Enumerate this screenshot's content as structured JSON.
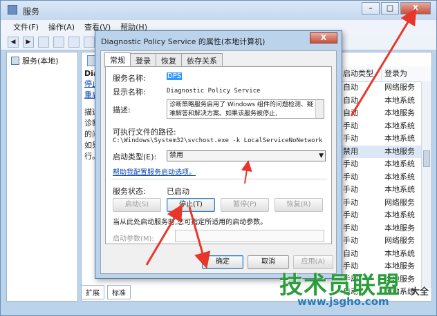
{
  "main": {
    "title": "服务",
    "menu": [
      "文件(F)",
      "操作(A)",
      "查看(V)",
      "帮助(H)"
    ],
    "tree_node": "服务(本地)",
    "desc": {
      "title": "Dia",
      "links": [
        "停止",
        "重启"
      ],
      "text": "描述\n诊断\n的问\n如果\n行。"
    },
    "columns": [
      "启动类型",
      "登录为"
    ],
    "rows": [
      [
        "自动",
        "网络服务"
      ],
      [
        "自动",
        "本地系统"
      ],
      [
        "自动",
        "本地服务"
      ],
      [
        "手动",
        "本地系统"
      ],
      [
        "手动",
        "本地系统"
      ],
      [
        "禁用",
        "本地服务"
      ],
      [
        "手动",
        "本地系统"
      ],
      [
        "手动",
        "本地系统"
      ],
      [
        "手动",
        "本地系统"
      ],
      [
        "手动",
        "网络服务"
      ],
      [
        "手动",
        "本地系统"
      ],
      [
        "手动",
        "本地服务"
      ],
      [
        "手动",
        "网络服务"
      ],
      [
        "自动",
        "本地系统"
      ],
      [
        "手动",
        "本地服务"
      ],
      [
        "手动",
        "本地服务"
      ],
      [
        "自动",
        "本地系统"
      ]
    ],
    "bottom_tabs": [
      "扩展",
      "标准"
    ]
  },
  "dialog": {
    "title": "Diagnostic Policy Service 的属性(本地计算机)",
    "close": "X",
    "tabs": [
      "常规",
      "登录",
      "恢复",
      "依存关系"
    ],
    "service_name_label": "服务名称:",
    "service_name_value": "DPS",
    "display_name_label": "显示名称:",
    "display_name_value": "Diagnostic Policy Service",
    "description_label": "描述:",
    "description_value": "诊断策略服务启用了 Windows 组件的问题检测、疑难解答和解决方案。如果该服务被停止,",
    "exe_path_label": "可执行文件的路径:",
    "exe_path_value": "C:\\Windows\\System32\\svchost.exe -k LocalServiceNoNetwork",
    "startup_type_label": "启动类型(E):",
    "startup_type_value": "禁用",
    "help_link": "帮助我配置服务启动选项。",
    "status_label": "服务状态:",
    "status_value": "已启动",
    "btn_start": "启动(S)",
    "btn_stop": "停止(T)",
    "btn_pause": "暂停(P)",
    "btn_resume": "恢复(R)",
    "start_params_note": "当从此处启动服务时,您可指定所适用的启动参数。",
    "start_params_label": "启动参数(M):",
    "ok": "确定",
    "cancel": "取消",
    "apply": "应用(A)"
  },
  "watermark": {
    "brand": "技术员联盟",
    "suffix": "大全",
    "url": "www.jsgho.com"
  },
  "colors": {
    "arrow": "#e8362a",
    "window_frame": "#bcd3ec",
    "link": "#0645ad"
  }
}
